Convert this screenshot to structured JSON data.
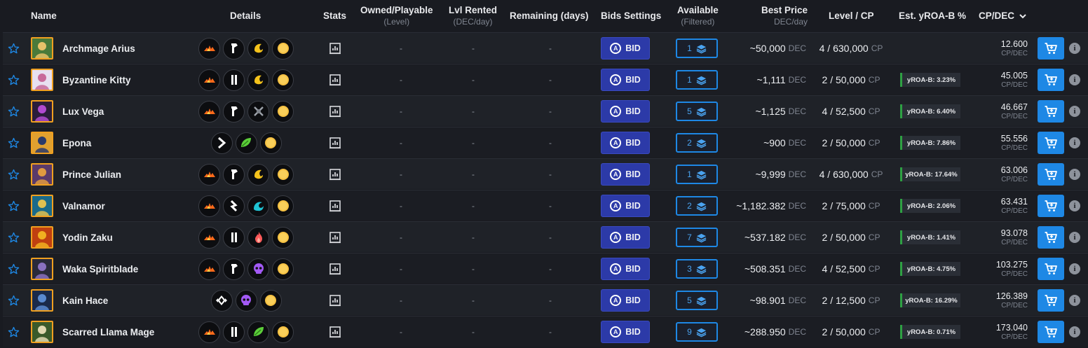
{
  "headers": {
    "name": "Name",
    "details": "Details",
    "stats": "Stats",
    "owned": "Owned/Playable",
    "owned_sub": "(Level)",
    "rented": "Lvl Rented",
    "rented_sub": "(DEC/day)",
    "remaining": "Remaining (days)",
    "bids": "Bids Settings",
    "available": "Available",
    "available_sub": "(Filtered)",
    "best_price": "Best Price",
    "best_price_sub": "DEC/day",
    "level_cp": "Level / CP",
    "yroa": "Est. yROA-B %",
    "cpdec": "CP/DEC"
  },
  "labels": {
    "bid": "BID",
    "dash": "-",
    "dec": "DEC",
    "cp": "CP",
    "cpdec_unit": "CP/DEC",
    "info": "i"
  },
  "colors": {
    "accent": "#1e88e5",
    "bid_button": "#2c3aa8",
    "yroa_bar": "#2ea043"
  },
  "rows": [
    {
      "name": "Archmage Arius",
      "details": [
        "fire-icon",
        "melee-icon",
        "crescent-icon",
        "coin-icon"
      ],
      "available": "1",
      "price": "~50,000",
      "level": "4 / 630,000",
      "yroa": "",
      "cpdec": "12.600"
    },
    {
      "name": "Byzantine Kitty",
      "details": [
        "fire-icon",
        "pillar-icon",
        "crescent-icon",
        "coin-icon"
      ],
      "available": "1",
      "price": "~1,111",
      "level": "2 / 50,000",
      "yroa": "yROA-B: 3.23%",
      "cpdec": "45.005"
    },
    {
      "name": "Lux Vega",
      "details": [
        "fire-icon",
        "melee-icon",
        "crossed-swords-icon",
        "coin-icon"
      ],
      "available": "5",
      "price": "~1,125",
      "level": "4 / 52,500",
      "yroa": "yROA-B: 6.40%",
      "cpdec": "46.667"
    },
    {
      "name": "Epona",
      "details": [
        "arrow-right-icon",
        "leaf-icon",
        "coin-icon"
      ],
      "available": "2",
      "price": "~900",
      "level": "2 / 50,000",
      "yroa": "yROA-B: 7.86%",
      "cpdec": "55.556"
    },
    {
      "name": "Prince Julian",
      "details": [
        "fire-icon",
        "melee-icon",
        "crescent-icon",
        "coin-icon"
      ],
      "available": "1",
      "price": "~9,999",
      "level": "4 / 630,000",
      "yroa": "yROA-B: 17.64%",
      "cpdec": "63.006"
    },
    {
      "name": "Valnamor",
      "details": [
        "fire-icon",
        "lightning-icon",
        "wave-icon",
        "coin-icon"
      ],
      "available": "2",
      "price": "~1,182.382",
      "level": "2 / 75,000",
      "yroa": "yROA-B: 2.06%",
      "cpdec": "63.431"
    },
    {
      "name": "Yodin Zaku",
      "details": [
        "fire-icon",
        "pillar-icon",
        "flame-icon",
        "coin-icon"
      ],
      "available": "7",
      "price": "~537.182",
      "level": "2 / 50,000",
      "yroa": "yROA-B: 1.41%",
      "cpdec": "93.078"
    },
    {
      "name": "Waka Spiritblade",
      "details": [
        "fire-icon",
        "melee-icon",
        "skull-icon",
        "coin-icon"
      ],
      "available": "3",
      "price": "~508.351",
      "level": "4 / 52,500",
      "yroa": "yROA-B: 4.75%",
      "cpdec": "103.275"
    },
    {
      "name": "Kain Hace",
      "details": [
        "diamond-icon",
        "skull-icon",
        "coin-icon"
      ],
      "available": "5",
      "price": "~98.901",
      "level": "2 / 12,500",
      "yroa": "yROA-B: 16.29%",
      "cpdec": "126.389"
    },
    {
      "name": "Scarred Llama Mage",
      "details": [
        "fire-icon",
        "pillar-icon",
        "leaf-icon",
        "coin-icon"
      ],
      "available": "9",
      "price": "~288.950",
      "level": "2 / 50,000",
      "yroa": "yROA-B: 0.71%",
      "cpdec": "173.040"
    }
  ]
}
